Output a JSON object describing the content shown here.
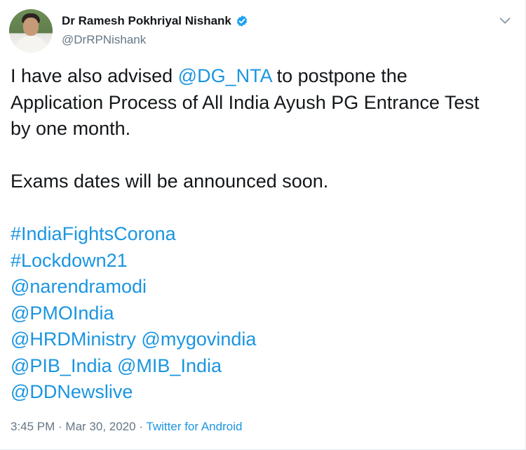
{
  "author": {
    "display_name": "Dr Ramesh Pokhriyal Nishank",
    "handle": "@DrRPNishank",
    "verified": true
  },
  "tweet": {
    "line1_text": "I have also advised ",
    "mention_nta": "@DG_NTA",
    "line1_rest": " to postpone the",
    "line2": "Application Process of All India Ayush PG Entrance Test",
    "line3": "by one month.",
    "line4": "Exams dates will be announced soon.",
    "hashtag1": "#IndiaFightsCorona",
    "hashtag2": "#Lockdown21",
    "mention1": "@narendramodi",
    "mention2": "@PMOIndia",
    "mention3": "@HRDMinistry",
    "mention4": "@mygovindia",
    "mention5": "@PIB_India",
    "mention6": "@MIB_India",
    "mention7": "@DDNewslive"
  },
  "meta": {
    "time": "3:45 PM",
    "separator": " · ",
    "date": "Mar 30, 2020",
    "source": "Twitter for Android"
  },
  "colors": {
    "link": "#1b95e0",
    "secondary_text": "#657786",
    "primary_text": "#14171a"
  },
  "icons": {
    "verified": "verified-badge-icon",
    "menu": "chevron-down-icon"
  }
}
